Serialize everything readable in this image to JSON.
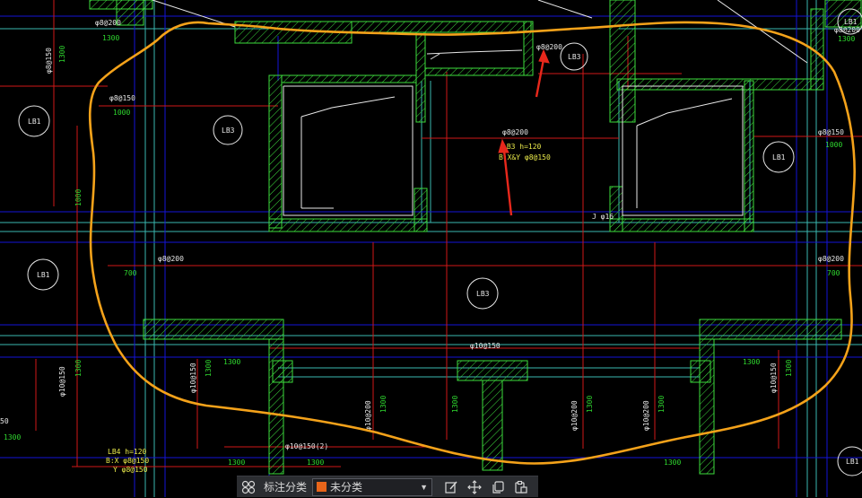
{
  "colors": {
    "wall": "#3ddc3d",
    "beam": "#1414d8",
    "cyan": "#3ab7b0",
    "red": "#d01818",
    "white": "#e8e8e8",
    "yellow": "#e8e84a",
    "green_text": "#2fd82f",
    "highlight": "#f4a21a",
    "arrow": "#e8281c",
    "swatch": "#e8651a"
  },
  "labels": {
    "lb3_a": "LB3",
    "lb3_b": "LB3",
    "lb3_c": "LB3",
    "lb1_a": "LB1",
    "lb1_b": "LB1",
    "lb1_c": "LB1",
    "lb1_d": "LB1",
    "lb1_e": "LB1",
    "lb1_f": "LB1",
    "rebar_top_left": "φ8@200",
    "dim_top_left": "1300",
    "rebar_top_mid": "φ8@200",
    "rebar_top_right": "φ8@200",
    "dim_top_right": "1300",
    "rebar_left_v": "φ8@150",
    "dim_left_v": "1300",
    "rebar_left_mid": "φ8@150",
    "dim_left_mid": "1000",
    "rebar_center": "φ8@200",
    "slab_h": "LB3 h=120",
    "slab_xy": "B:X&Y φ8@150",
    "rebar_right_mid": "φ8@150",
    "dim_right_mid": "1000",
    "dim_left_v2": "1000",
    "note_jc": "J φ16",
    "rebar_mid_left": "φ8@200",
    "dim_mid_left": "700",
    "rebar_mid_right": "φ8@200",
    "dim_mid_right": "700",
    "rebar_bottom_center": "φ10@150",
    "rebar_b1": "φ10@150",
    "dim_b1": "1300",
    "rebar_b2": "φ10@150",
    "dim_b2": "1300",
    "dim_b2b": "1300",
    "rebar_b3": "φ10@200",
    "dim_b3": "1300",
    "dim_b3b": "1300",
    "rebar_b4": "φ10@200",
    "dim_b4": "1300",
    "rebar_b5": "φ10@200",
    "dim_b5": "1300",
    "rebar_b6": "φ10@150",
    "dim_b6": "1300",
    "dim_b7": "1300",
    "rebar_bottom_span": "φ10@150(2)",
    "dim_bottom_1": "1300",
    "dim_bottom_2": "1300",
    "dim_bottom_3": "1300",
    "slab2_h": "LB4 h=120",
    "slab2_x": "B:X φ8@150",
    "slab2_y": "Y φ8@150",
    "dim_left_edge": "1300",
    "dim_left_edge2": "50"
  },
  "toolbar": {
    "category_label": "标注分类",
    "select_value": "未分类",
    "tools": [
      "grid-view",
      "edit",
      "move",
      "copy",
      "paste"
    ]
  }
}
